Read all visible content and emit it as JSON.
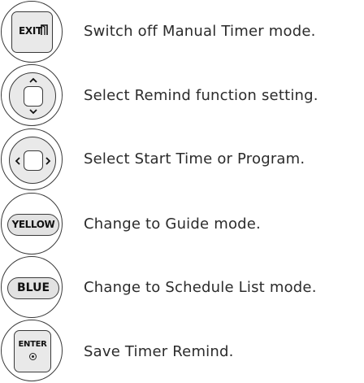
{
  "items": [
    {
      "key": "EXIT",
      "icon": "exit-key-icon",
      "description": "Switch off Manual Timer mode."
    },
    {
      "key": "",
      "icon": "up-down-key-icon",
      "description": "Select Remind function setting."
    },
    {
      "key": "",
      "icon": "left-right-key-icon",
      "description": "Select Start Time or Program."
    },
    {
      "key": "YELLOW",
      "icon": "yellow-key-icon",
      "description": "Change to Guide mode."
    },
    {
      "key": "BLUE",
      "icon": "blue-key-icon",
      "description": "Change to Schedule List mode."
    },
    {
      "key": "ENTER",
      "icon": "enter-key-icon",
      "description": "Save Timer Remind."
    }
  ]
}
